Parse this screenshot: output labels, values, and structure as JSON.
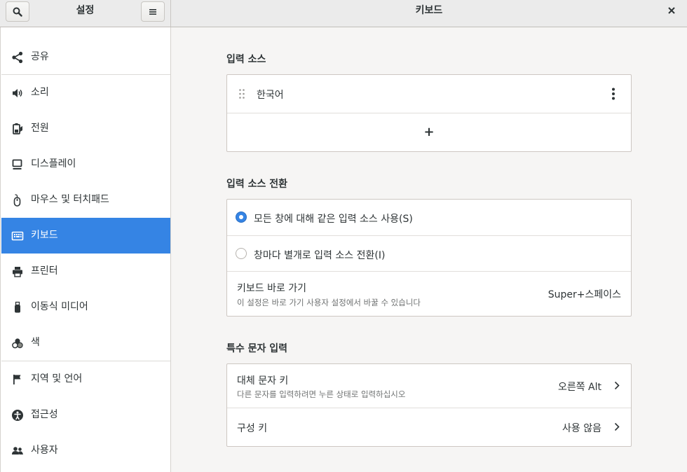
{
  "header": {
    "search_icon": "search-icon",
    "sidebar_title": "설정",
    "menu_icon": "hamburger-menu-icon",
    "page_title": "키보드",
    "close_icon": "close-icon"
  },
  "sidebar": {
    "items": [
      {
        "label": "공유",
        "icon": "share-icon"
      },
      {
        "label": "소리",
        "icon": "speaker-icon"
      },
      {
        "label": "전원",
        "icon": "battery-icon"
      },
      {
        "label": "디스플레이",
        "icon": "display-icon"
      },
      {
        "label": "마우스 및 터치패드",
        "icon": "mouse-icon"
      },
      {
        "label": "키보드",
        "icon": "keyboard-icon",
        "active": true
      },
      {
        "label": "프린터",
        "icon": "printer-icon"
      },
      {
        "label": "이동식 미디어",
        "icon": "usb-media-icon"
      },
      {
        "label": "색",
        "icon": "color-icon"
      },
      {
        "label": "지역 및 언어",
        "icon": "flag-icon"
      },
      {
        "label": "접근성",
        "icon": "accessibility-icon"
      },
      {
        "label": "사용자",
        "icon": "users-icon"
      }
    ]
  },
  "input_sources": {
    "title": "입력 소스",
    "items": [
      {
        "label": "한국어"
      }
    ],
    "add_label": "+"
  },
  "input_switching": {
    "title": "입력 소스 전환",
    "option_same": "모든 창에 대해 같은 입력 소스 사용(S)",
    "option_per_window": "창마다 별개로 입력 소스 전환(I)",
    "selected": "option_same",
    "shortcut_label": "키보드 바로 가기",
    "shortcut_hint": "이 설정은 바로 가기 사용자 설정에서 바꿀 수 있습니다",
    "shortcut_value": "Super+스페이스"
  },
  "special_chars": {
    "title": "특수 문자 입력",
    "alt_key_label": "대체 문자 키",
    "alt_key_hint": "다른 문자를 입력하려면 누른 상태로 입력하십시오",
    "alt_key_value": "오른쪽 Alt",
    "compose_label": "구성 키",
    "compose_value": "사용 않음"
  },
  "colors": {
    "accent": "#3584e4",
    "sidebar_bg": "#ffffff",
    "content_bg": "#f6f5f4",
    "headerbar_bg": "#ebebeb"
  }
}
